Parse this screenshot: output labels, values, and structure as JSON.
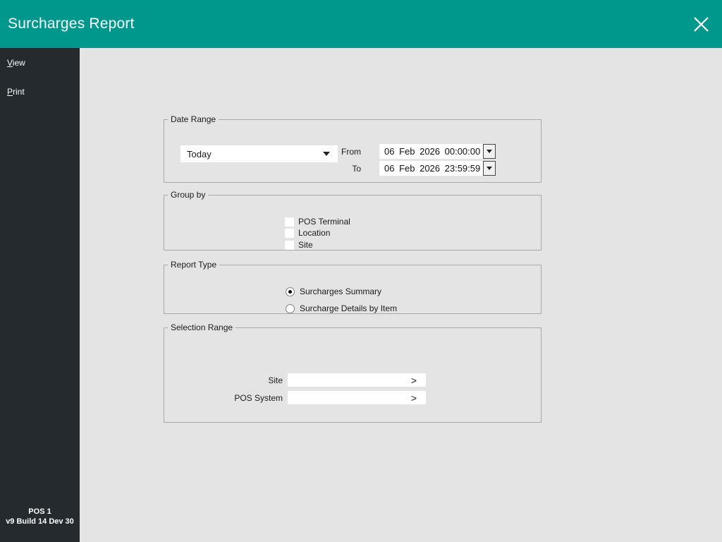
{
  "header": {
    "title": "Surcharges Report"
  },
  "sidebar": {
    "items": [
      {
        "accel": "V",
        "rest": "iew"
      },
      {
        "accel": "P",
        "rest": "rint"
      }
    ],
    "footer_line1": "POS 1",
    "footer_line2": "v9 Build 14 Dev 30"
  },
  "date_range": {
    "legend": "Date Range",
    "preset_value": "Today",
    "from_label": "From",
    "from_value": "06 Feb 2026 00:00:00",
    "to_label": "To",
    "to_value": "06 Feb 2026 23:59:59"
  },
  "group_by": {
    "legend": "Group by",
    "options": [
      {
        "label": "POS Terminal",
        "checked": false
      },
      {
        "label": "Location",
        "checked": false
      },
      {
        "label": "Site",
        "checked": false
      }
    ]
  },
  "report_type": {
    "legend": "Report Type",
    "options": [
      {
        "label": "Surcharges Summary",
        "selected": true
      },
      {
        "label": "Surcharge Details by Item",
        "selected": false
      }
    ]
  },
  "selection_range": {
    "legend": "Selection Range",
    "fields": [
      {
        "label": "Site",
        "value": "",
        "chevron": ">"
      },
      {
        "label": "POS System",
        "value": "",
        "chevron": ">"
      }
    ]
  },
  "colors": {
    "accent": "#00988C",
    "sidebar_bg": "#242A2E",
    "content_bg": "#E4E4E4",
    "groupbox_border": "#A8A8A8"
  }
}
